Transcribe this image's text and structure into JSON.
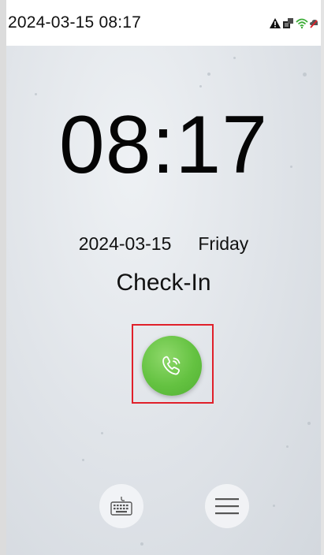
{
  "status_bar": {
    "datetime": "2024-03-15 08:17",
    "icons": [
      "warning-icon",
      "network-icon",
      "wifi-icon",
      "cloud-offline-icon"
    ]
  },
  "clock": {
    "time": "08:17"
  },
  "date": {
    "date": "2024-03-15",
    "weekday": "Friday"
  },
  "mode": {
    "label": "Check-In"
  },
  "actions": {
    "call_icon": "phone-call-icon",
    "keyboard_icon": "keyboard-icon",
    "menu_icon": "menu-icon"
  },
  "colors": {
    "call_button": "#64c241",
    "highlight_frame": "#e0202a",
    "text": "#111111"
  }
}
